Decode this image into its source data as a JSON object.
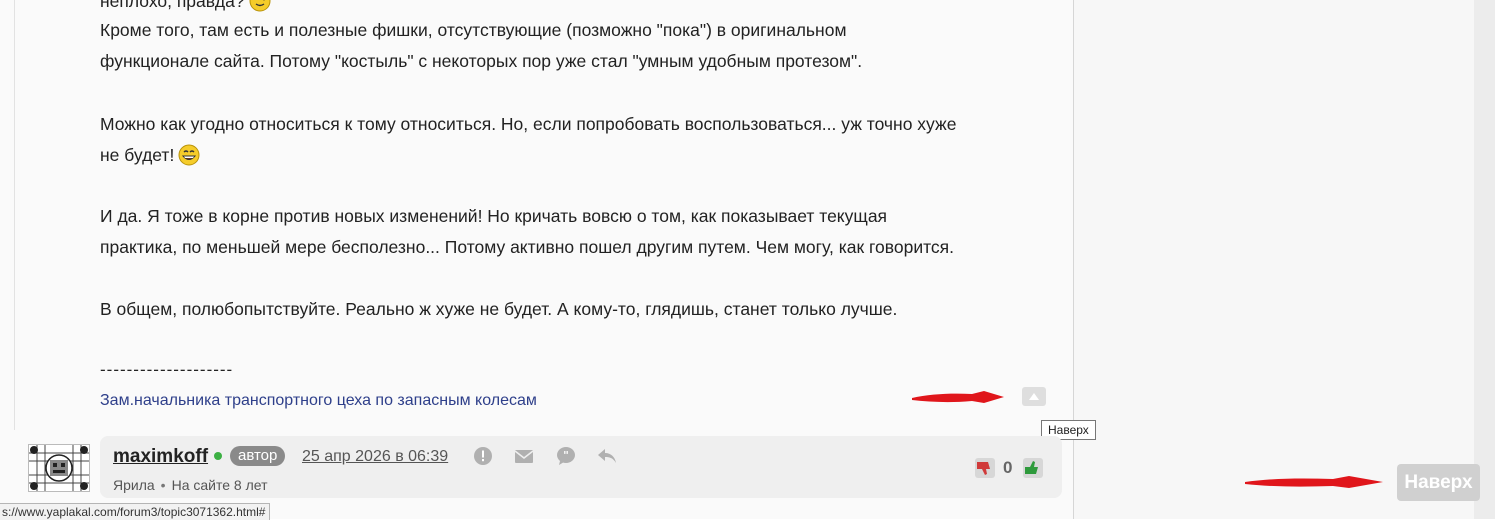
{
  "post": {
    "line_0": "неплохо, правда?",
    "line_1": "Кроме того, там есть и полезные фишки, отсутствующие (позможно \"пока\") в оригинальном",
    "line_2": "функционале сайта. Потому \"костыль\" с некоторых пор уже стал \"умным удобным протезом\".",
    "line_3": "Можно как угодно относиться к тому относиться. Но, если попробовать воспользоваться... уж точно хуже",
    "line_4": "не будет!",
    "line_5": "И да. Я тоже в корне против новых изменений! Но кричать вовсю о том, как показывает текущая",
    "line_6": "практика, по меньшей мере бесполезно... Потому активно пошел другим путем. Чем могу, как говорится.",
    "line_7": "В общем, полюбопытствуйте. Реально ж хуже не будет. А кому-то, глядишь, станет только лучше."
  },
  "signature": {
    "dashes": "--------------------",
    "text": "Зам.начальника транспортного цеха по запасным колесам"
  },
  "tooltip": "Наверх",
  "author": {
    "username": "maximkoff",
    "badge": "автор",
    "date": "25 апр 2026 в 06:39",
    "rank": "Ярила",
    "separator": "•",
    "online_time": "На сайте 8 лет"
  },
  "votes": {
    "count": "0"
  },
  "naverh_button": "Наверх",
  "status_url": "s://www.yaplakal.com/forum3/topic3071362.html#",
  "colors": {
    "signature_link": "#2e3f8a",
    "online": "#3cb043",
    "annotation_red": "#e0161b"
  }
}
